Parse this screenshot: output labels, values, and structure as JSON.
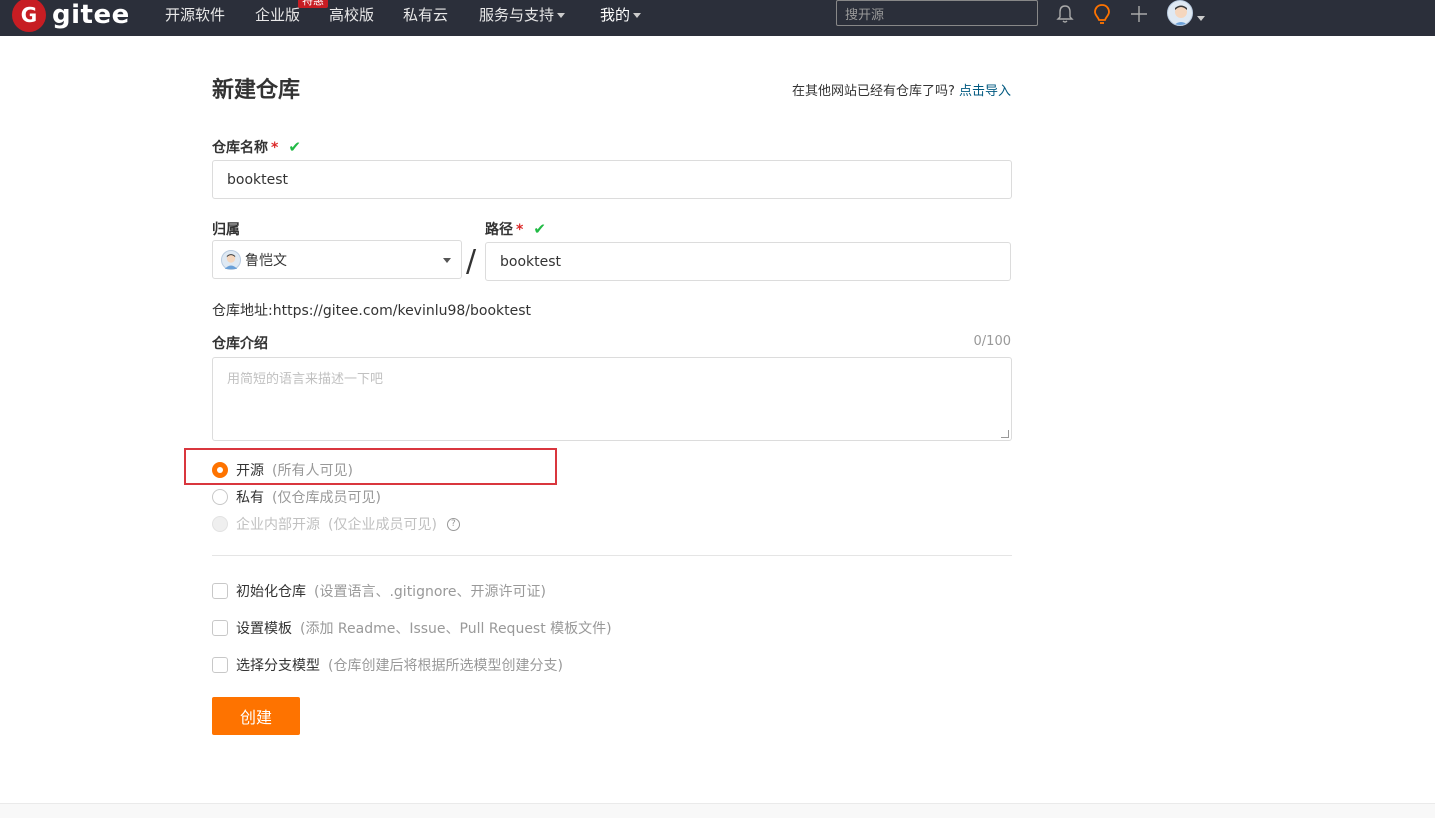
{
  "nav": {
    "logo_letter": "G",
    "logo_text": "gitee",
    "items": [
      {
        "label": "开源软件"
      },
      {
        "label": "企业版"
      },
      {
        "label": "高校版"
      },
      {
        "label": "私有云"
      },
      {
        "label": "服务与支持"
      },
      {
        "label": "我的"
      }
    ],
    "promo_badge": "特惠",
    "search_placeholder": "搜开源",
    "icons": [
      "bell-icon",
      "lightbulb-icon",
      "plus-icon",
      "avatar"
    ]
  },
  "page": {
    "title": "新建仓库",
    "import_question": "在其他网站已经有仓库了吗?",
    "import_link": "点击导入"
  },
  "form": {
    "repo_name_label": "仓库名称",
    "required_mark": "*",
    "check_mark": "✔",
    "repo_name_value": "booktest",
    "owner_label": "归属",
    "owner_value": "鲁恺文",
    "path_label": "路径",
    "path_value": "booktest",
    "slash": "/",
    "address_label": "仓库地址:",
    "address_value": "https://gitee.com/kevinlu98/booktest",
    "intro_label": "仓库介绍",
    "intro_counter": "0/100",
    "intro_placeholder": "用简短的语言来描述一下吧",
    "visibility": [
      {
        "label": "开源",
        "hint": "(所有人可见)",
        "selected": true
      },
      {
        "label": "私有",
        "hint": "(仅仓库成员可见)",
        "selected": false
      },
      {
        "label": "企业内部开源",
        "hint": "(仅企业成员可见)",
        "selected": false,
        "disabled": true
      }
    ],
    "help_icon": "?",
    "options": [
      {
        "label": "初始化仓库",
        "hint": "(设置语言、.gitignore、开源许可证)"
      },
      {
        "label": "设置模板",
        "hint": "(添加 Readme、Issue、Pull Request 模板文件)"
      },
      {
        "label": "选择分支模型",
        "hint": "(仓库创建后将根据所选模型创建分支)"
      }
    ],
    "submit_label": "创建"
  },
  "colors": {
    "nav_bg": "#2b2f3a",
    "brand_red": "#c71d23",
    "accent_orange": "#fe7300",
    "link": "#005980",
    "success": "#21ba45",
    "highlight": "#d9363e"
  }
}
